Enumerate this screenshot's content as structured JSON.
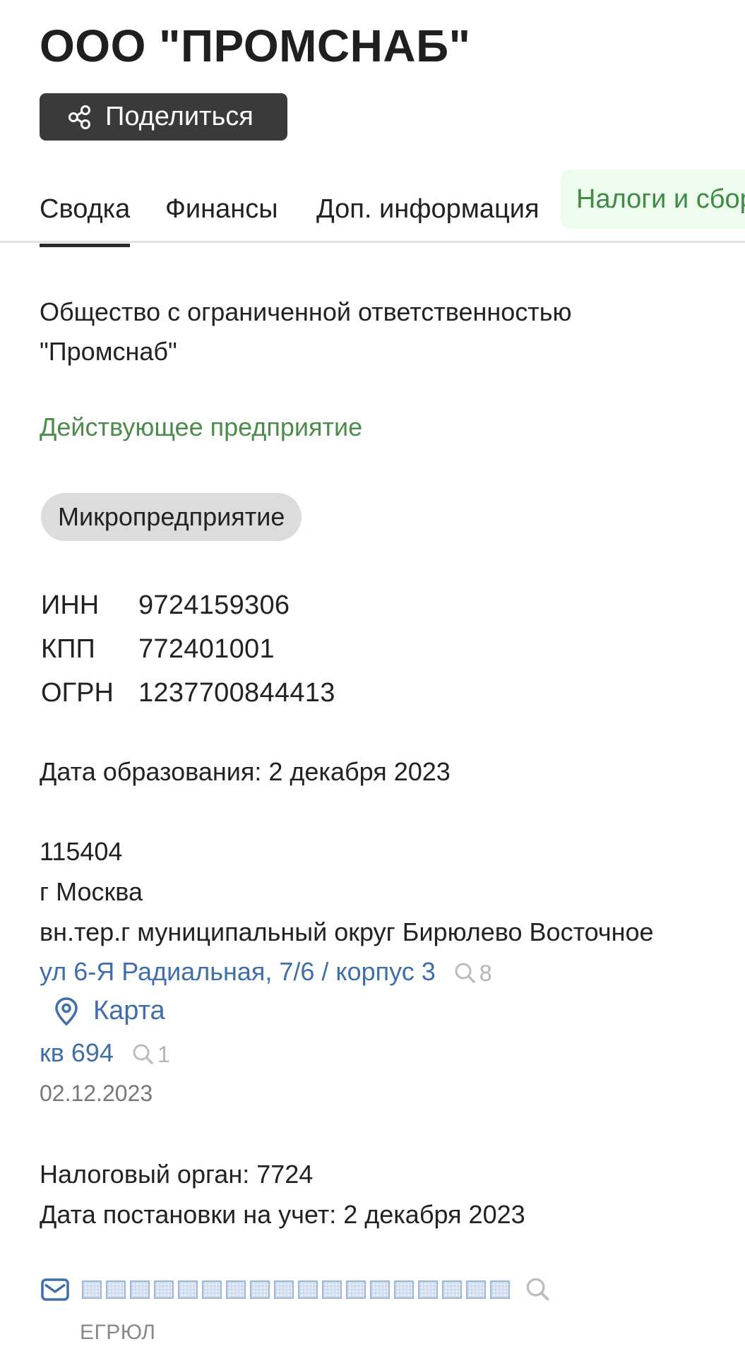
{
  "header": {
    "title": "ООО \"ПРОМСНАБ\"",
    "share_label": "Поделиться"
  },
  "tabs": [
    {
      "label": "Сводка",
      "active": true
    },
    {
      "label": "Финансы",
      "active": false
    },
    {
      "label": "Доп. информация",
      "active": false
    },
    {
      "label": "Налоги и сбор",
      "active": false
    }
  ],
  "company": {
    "full_name_line1": "Общество с ограниченной ответственностью",
    "full_name_line2": "\"Промснаб\"",
    "status": "Действующее предприятие",
    "size_badge": "Микропредприятие"
  },
  "registration": [
    {
      "key": "ИНН",
      "value": "9724159306"
    },
    {
      "key": "КПП",
      "value": "772401001"
    },
    {
      "key": "ОГРН",
      "value": "1237700844413"
    }
  ],
  "formation_date": "Дата образования: 2 декабря 2023",
  "address": {
    "postcode": "115404",
    "city": "г Москва",
    "district": "вн.тер.г муниципальный округ Бирюлево Восточное",
    "street": "ул 6-Я Радиальная, 7/6 / корпус 3",
    "street_search_count": "8",
    "map_label": "Карта",
    "apartment": "кв 694",
    "apartment_search_count": "1",
    "date": "02.12.2023"
  },
  "tax": {
    "authority": "Налоговый орган: 7724",
    "registration_date": "Дата постановки на учет: 2 декабря 2023"
  },
  "email": {
    "source": "ЕГРЮЛ"
  },
  "colors": {
    "status_green": "#4a8d4b",
    "link_blue": "#3f6ea8",
    "button_dark": "#3a3a3a",
    "tab_highlight_bg": "#eefbef"
  }
}
